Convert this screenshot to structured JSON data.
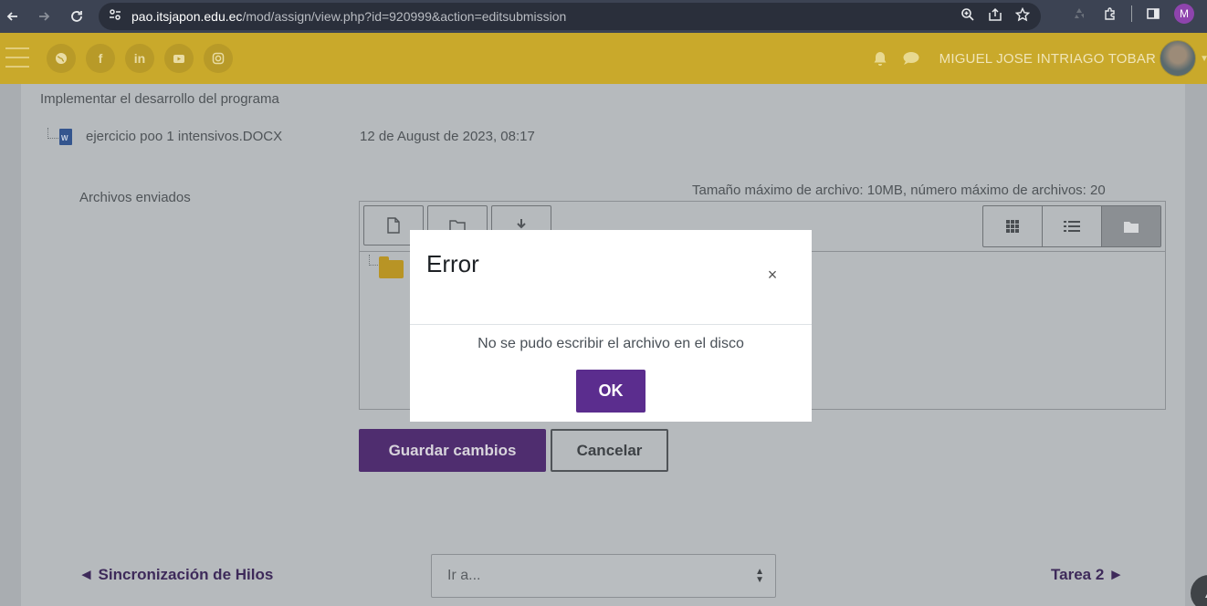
{
  "browser": {
    "url_host": "pao.itsjapon.edu.ec",
    "url_path": "/mod/assign/view.php?id=920999&action=editsubmission",
    "profile_initial": "M"
  },
  "header": {
    "user_name": "MIGUEL JOSE INTRIAGO TOBAR",
    "social_icons": [
      "globe-icon",
      "facebook-icon",
      "linkedin-icon",
      "youtube-icon",
      "instagram-icon"
    ]
  },
  "submission": {
    "task_text": "Implementar el desarrollo del programa",
    "file_name": "ejercicio poo 1 intensivos.DOCX",
    "file_date": "12 de August de 2023, 08:17",
    "section_label": "Archivos enviados",
    "limits_text": "Tamaño máximo de archivo: 10MB, número máximo de archivos: 20"
  },
  "actions": {
    "save_label": "Guardar cambios",
    "cancel_label": "Cancelar"
  },
  "footer_nav": {
    "prev_label": "◄ Sincronización de Hilos",
    "jump_placeholder": "Ir a...",
    "next_label": "Tarea 2 ►"
  },
  "modal": {
    "title": "Error",
    "message": "No se pudo escribir el archivo en el disco",
    "ok_label": "OK",
    "close_glyph": "×"
  },
  "colors": {
    "header_bg": "#c9a92b",
    "primary": "#5b2d8e",
    "chrome_bg": "#3c4353"
  }
}
